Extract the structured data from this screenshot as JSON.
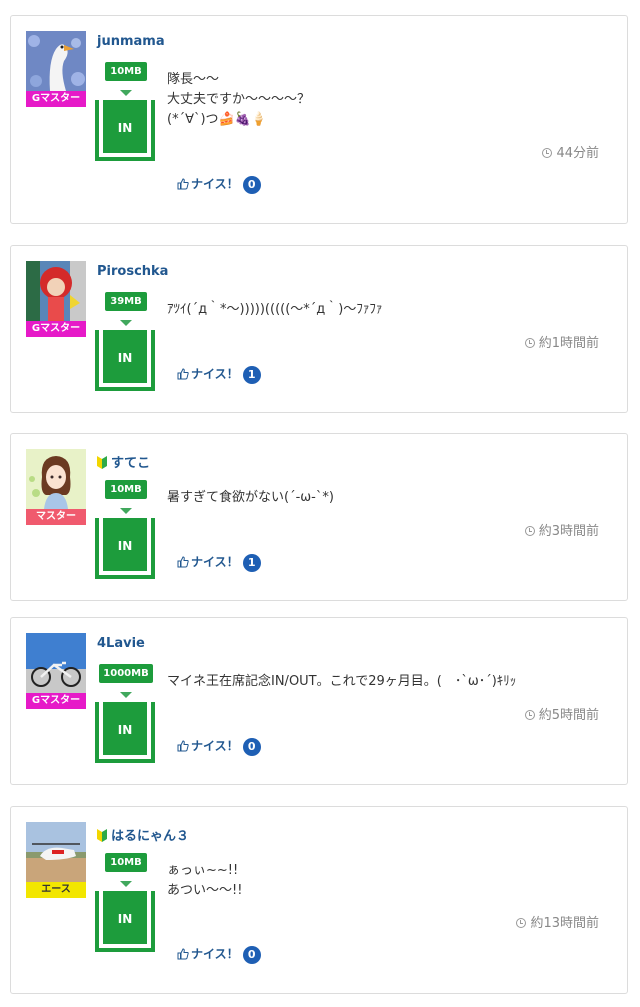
{
  "posts": [
    {
      "user": "junmama",
      "beginner": false,
      "rank": "Gマスター",
      "rank_color": "#e61ac8",
      "size": "10MB",
      "gauge": "IN",
      "message": [
        "隊長～～",
        "大丈夫ですか～～～～？",
        "(*´∀`)つ🍰🍇🍦"
      ],
      "time": "44分前",
      "nice_label": "ナイス！",
      "nice_count": "0"
    },
    {
      "user": "Piroschka",
      "beginner": false,
      "rank": "Gマスター",
      "rank_color": "#e61ac8",
      "size": "39MB",
      "gauge": "IN",
      "message": [
        "ｱﾂｲ(´д｀*～)))))(((((～*´д｀)～ﾌｧﾌｧ"
      ],
      "time": "約1時間前",
      "nice_label": "ナイス！",
      "nice_count": "1"
    },
    {
      "user": "すてこ",
      "beginner": true,
      "rank": "マスター",
      "rank_color": "#f05a6e",
      "size": "10MB",
      "gauge": "IN",
      "message": [
        "暑すぎて食欲がない(´-ω-`*)"
      ],
      "time": "約3時間前",
      "nice_label": "ナイス！",
      "nice_count": "1"
    },
    {
      "user": "4Lavie",
      "beginner": false,
      "rank": "Gマスター",
      "rank_color": "#e61ac8",
      "size": "1000MB",
      "gauge": "IN",
      "message": [
        "マイネ王在席記念IN/OUT。これで29ヶ月目。(　･`ω･´)ｷﾘｯ"
      ],
      "time": "約5時間前",
      "nice_label": "ナイス！",
      "nice_count": "0"
    },
    {
      "user": "はるにゃん３",
      "beginner": true,
      "rank": "エース",
      "rank_color": "#f2e600",
      "rank_text_color": "#333333",
      "size": "10MB",
      "gauge": "IN",
      "message": [
        "ぁっぃ~~!!",
        "あつい～～!!"
      ],
      "time": "約13時間前",
      "nice_label": "ナイス！",
      "nice_count": "0"
    }
  ]
}
